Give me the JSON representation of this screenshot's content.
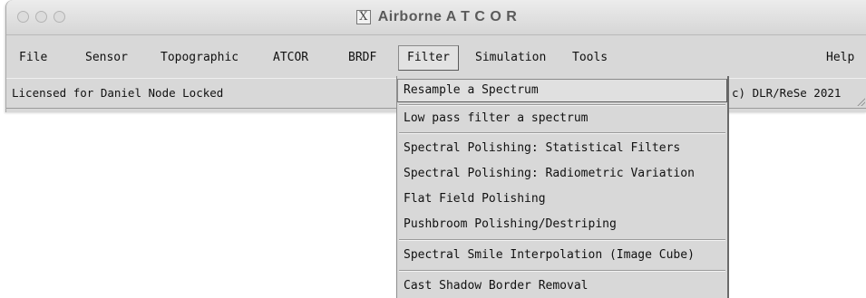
{
  "window": {
    "title": "Airborne A T C O R",
    "icon": "x11-icon",
    "icon_glyph": "X"
  },
  "menubar": {
    "items": [
      {
        "label": "File"
      },
      {
        "label": "Sensor"
      },
      {
        "label": "Topographic"
      },
      {
        "label": "ATCOR"
      },
      {
        "label": "BRDF"
      },
      {
        "label": "Filter",
        "active": true
      },
      {
        "label": "Simulation"
      },
      {
        "label": "Tools"
      },
      {
        "label": "Help"
      }
    ]
  },
  "status": {
    "license": "Licensed for Daniel Node Locked",
    "copyright": "c) DLR/ReSe 2021"
  },
  "filter_menu": {
    "items": [
      {
        "label": "Resample a Spectrum",
        "highlighted": true
      },
      {
        "label": "Low pass filter a spectrum"
      },
      {
        "label": "Spectral Polishing: Statistical Filters"
      },
      {
        "label": "Spectral Polishing: Radiometric Variation"
      },
      {
        "label": "Flat Field Polishing"
      },
      {
        "label": "Pushbroom Polishing/Destriping"
      },
      {
        "label": "Spectral Smile Interpolation (Image Cube)"
      },
      {
        "label": "Cast Shadow Border Removal"
      }
    ]
  }
}
